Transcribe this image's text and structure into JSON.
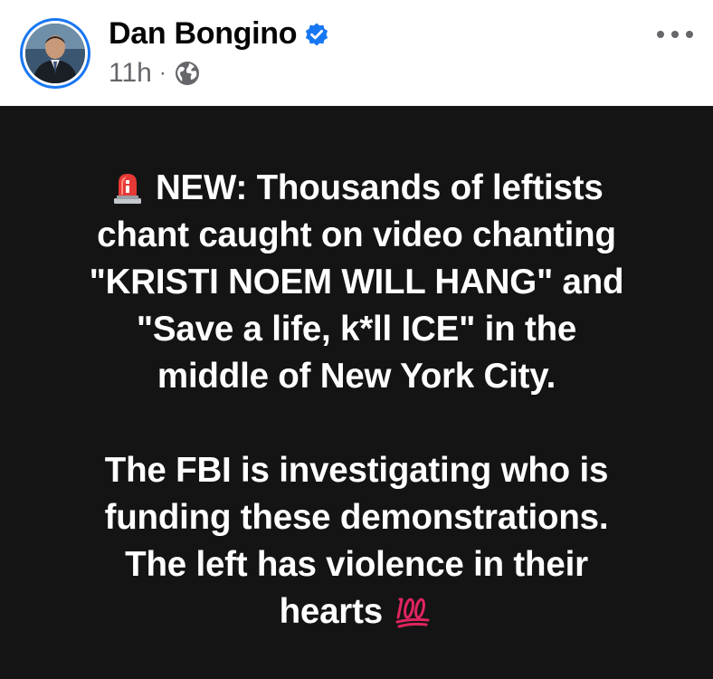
{
  "post": {
    "author": "Dan Bongino",
    "verified": true,
    "timestamp": "11h",
    "separator": "·",
    "audience_icon": "globe-icon",
    "more_icon": "more-options-icon",
    "accent_color": "#1877f2",
    "background_color": "#141414",
    "text_color": "#ffffff",
    "lines": [
      "NEW: Thousands of leftists",
      "chant caught on video chanting",
      "\"KRISTI NOEM WILL HANG\" and",
      "\"Save a life, k*ll ICE\" in the",
      "middle of New York City.",
      "The FBI is investigating who is",
      "funding these demonstrations.",
      "The left has violence in their",
      "hearts"
    ],
    "leading_emoji": "police-siren-icon",
    "trailing_emoji": "hundred-points-icon"
  }
}
